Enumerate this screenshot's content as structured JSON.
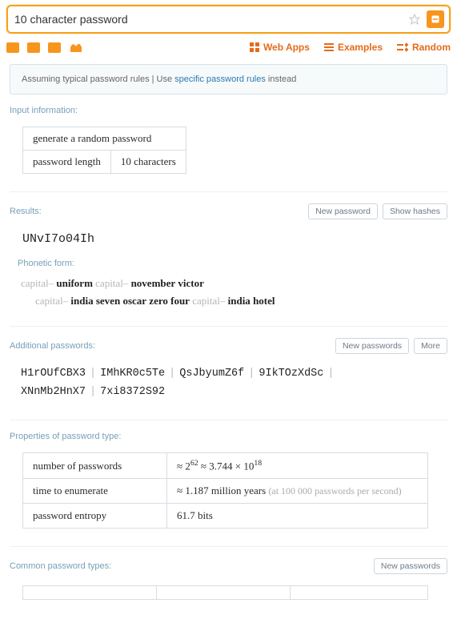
{
  "searchbar": {
    "query": "10 character password"
  },
  "toolbar": {
    "webapps": "Web Apps",
    "examples": "Examples",
    "random": "Random"
  },
  "assumption": {
    "prefix": "Assuming typical password rules | Use ",
    "link": "specific password rules",
    "suffix": " instead"
  },
  "input_info": {
    "title": "Input information:",
    "row1": "generate a random password",
    "row2_label": "password length",
    "row2_value": "10 characters"
  },
  "results": {
    "title": "Results:",
    "btn_new": "New password",
    "btn_show": "Show hashes",
    "password": "UNvI7o04Ih",
    "phonetic_label": "Phonetic form:",
    "phonetic_parts": [
      {
        "t": "capital– ",
        "g": true
      },
      {
        "t": "uniform",
        "b": true
      },
      {
        "t": "  "
      },
      {
        "t": "capital– ",
        "g": true
      },
      {
        "t": "november",
        "b": true
      },
      {
        "t": "  "
      },
      {
        "t": "victor",
        "b": true
      },
      {
        "t": "\n"
      },
      {
        "t": "    "
      },
      {
        "t": "capital– ",
        "g": true
      },
      {
        "t": "india",
        "b": true
      },
      {
        "t": "  "
      },
      {
        "t": "seven",
        "b": true
      },
      {
        "t": "  "
      },
      {
        "t": "oscar",
        "b": true
      },
      {
        "t": "  "
      },
      {
        "t": "zero",
        "b": true
      },
      {
        "t": "  "
      },
      {
        "t": "four",
        "b": true
      },
      {
        "t": "  "
      },
      {
        "t": "capital– ",
        "g": true
      },
      {
        "t": "india",
        "b": true
      },
      {
        "t": "  "
      },
      {
        "t": "hotel",
        "b": true
      }
    ]
  },
  "additional": {
    "title": "Additional passwords:",
    "btn_new": "New passwords",
    "btn_more": "More",
    "items": [
      "H1rOUfCBX3",
      "IMhKR0c5Te",
      "QsJbyumZ6f",
      "9IkTOzXdSc",
      "XNnMb2HnX7",
      "7xi8372S92"
    ]
  },
  "properties": {
    "title": "Properties of password type:",
    "rows": [
      {
        "label": "number of passwords",
        "value": "≈ 2<sup>62</sup> ≈ 3.744 × 10<sup>18</sup>"
      },
      {
        "label": "time to enumerate",
        "value": "≈ 1.187 million years <span class=\"grey\">(at 100 000 passwords per second)</span>"
      },
      {
        "label": "password entropy",
        "value": "61.7 bits"
      }
    ]
  },
  "common": {
    "title": "Common password types:",
    "btn_new": "New passwords"
  }
}
